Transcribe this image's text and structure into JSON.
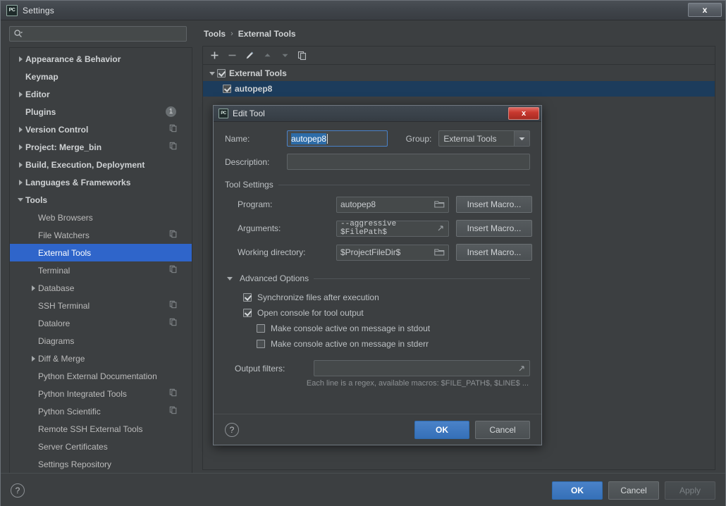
{
  "window": {
    "title": "Settings",
    "icon": "pycharm-icon",
    "close_label": "x"
  },
  "search": {
    "value": "",
    "placeholder": "",
    "icon": "search-icon"
  },
  "sidebar": {
    "items": [
      {
        "label": "Appearance & Behavior",
        "level": 0,
        "arrow": "collapsed",
        "bold": true
      },
      {
        "label": "Keymap",
        "level": 0,
        "arrow": "none",
        "bold": true
      },
      {
        "label": "Editor",
        "level": 0,
        "arrow": "collapsed",
        "bold": true
      },
      {
        "label": "Plugins",
        "level": 0,
        "arrow": "none",
        "bold": true,
        "badge": "1"
      },
      {
        "label": "Version Control",
        "level": 0,
        "arrow": "collapsed",
        "bold": true,
        "copy_icon": true
      },
      {
        "label": "Project: Merge_bin",
        "level": 0,
        "arrow": "collapsed",
        "bold": true,
        "copy_icon": true
      },
      {
        "label": "Build, Execution, Deployment",
        "level": 0,
        "arrow": "collapsed",
        "bold": true
      },
      {
        "label": "Languages & Frameworks",
        "level": 0,
        "arrow": "collapsed",
        "bold": true
      },
      {
        "label": "Tools",
        "level": 0,
        "arrow": "expanded",
        "bold": true
      },
      {
        "label": "Web Browsers",
        "level": 1,
        "arrow": "none",
        "bold": false
      },
      {
        "label": "File Watchers",
        "level": 1,
        "arrow": "none",
        "bold": false,
        "copy_icon": true
      },
      {
        "label": "External Tools",
        "level": 1,
        "arrow": "none",
        "bold": false,
        "selected": true
      },
      {
        "label": "Terminal",
        "level": 1,
        "arrow": "none",
        "bold": false,
        "copy_icon": true
      },
      {
        "label": "Database",
        "level": 1,
        "arrow": "collapsed",
        "bold": false
      },
      {
        "label": "SSH Terminal",
        "level": 1,
        "arrow": "none",
        "bold": false,
        "copy_icon": true
      },
      {
        "label": "Datalore",
        "level": 1,
        "arrow": "none",
        "bold": false,
        "copy_icon": true
      },
      {
        "label": "Diagrams",
        "level": 1,
        "arrow": "none",
        "bold": false
      },
      {
        "label": "Diff & Merge",
        "level": 1,
        "arrow": "collapsed",
        "bold": false
      },
      {
        "label": "Python External Documentation",
        "level": 1,
        "arrow": "none",
        "bold": false
      },
      {
        "label": "Python Integrated Tools",
        "level": 1,
        "arrow": "none",
        "bold": false,
        "copy_icon": true
      },
      {
        "label": "Python Scientific",
        "level": 1,
        "arrow": "none",
        "bold": false,
        "copy_icon": true
      },
      {
        "label": "Remote SSH External Tools",
        "level": 1,
        "arrow": "none",
        "bold": false
      },
      {
        "label": "Server Certificates",
        "level": 1,
        "arrow": "none",
        "bold": false
      },
      {
        "label": "Settings Repository",
        "level": 1,
        "arrow": "none",
        "bold": false
      }
    ]
  },
  "breadcrumb": {
    "root": "Tools",
    "separator": "›",
    "current": "External Tools"
  },
  "toolbar": {
    "buttons": [
      {
        "name": "add-button",
        "icon": "plus-icon"
      },
      {
        "name": "remove-button",
        "icon": "minus-icon"
      },
      {
        "name": "edit-button",
        "icon": "pencil-icon"
      },
      {
        "name": "move-up-button",
        "icon": "arrow-up-icon"
      },
      {
        "name": "move-down-button",
        "icon": "arrow-down-icon"
      },
      {
        "name": "copy-button",
        "icon": "copy-icon"
      }
    ]
  },
  "tool_list": {
    "group": {
      "label": "External Tools",
      "checked": true,
      "expanded": true
    },
    "items": [
      {
        "label": "autopep8",
        "checked": true,
        "selected": true
      }
    ]
  },
  "footer": {
    "help": "?",
    "ok": "OK",
    "cancel": "Cancel",
    "apply": "Apply"
  },
  "dialog": {
    "title": "Edit Tool",
    "icon": "pycharm-icon",
    "close_label": "x",
    "name_label": "Name:",
    "name_value": "autopep8",
    "group_label": "Group:",
    "group_value": "External Tools",
    "description_label": "Description:",
    "description_value": "",
    "tool_settings_label": "Tool Settings",
    "program_label": "Program:",
    "program_value": "autopep8",
    "arguments_label": "Arguments:",
    "arguments_value": "--aggressive $FilePath$",
    "working_dir_label": "Working directory:",
    "working_dir_value": "$ProjectFileDir$",
    "insert_macro_label": "Insert Macro...",
    "advanced_options_label": "Advanced Options",
    "checkboxes": [
      {
        "label": "Synchronize files after execution",
        "checked": true,
        "indent": 0
      },
      {
        "label": "Open console for tool output",
        "checked": true,
        "indent": 0
      },
      {
        "label": "Make console active on message in stdout",
        "checked": false,
        "indent": 1
      },
      {
        "label": "Make console active on message in stderr",
        "checked": false,
        "indent": 1
      }
    ],
    "output_filters_label": "Output filters:",
    "output_filters_value": "",
    "output_hint": "Each line is a regex, available macros: $FILE_PATH$, $LINE$ ...",
    "help": "?",
    "ok": "OK",
    "cancel": "Cancel"
  },
  "colors": {
    "background": "#3c3f41",
    "selection_blue": "#2f65ca",
    "list_selection": "#1c3c5c",
    "accent_button": "#3570b8",
    "text_selection": "#2d6ca8",
    "close_red": "#c8392f"
  }
}
